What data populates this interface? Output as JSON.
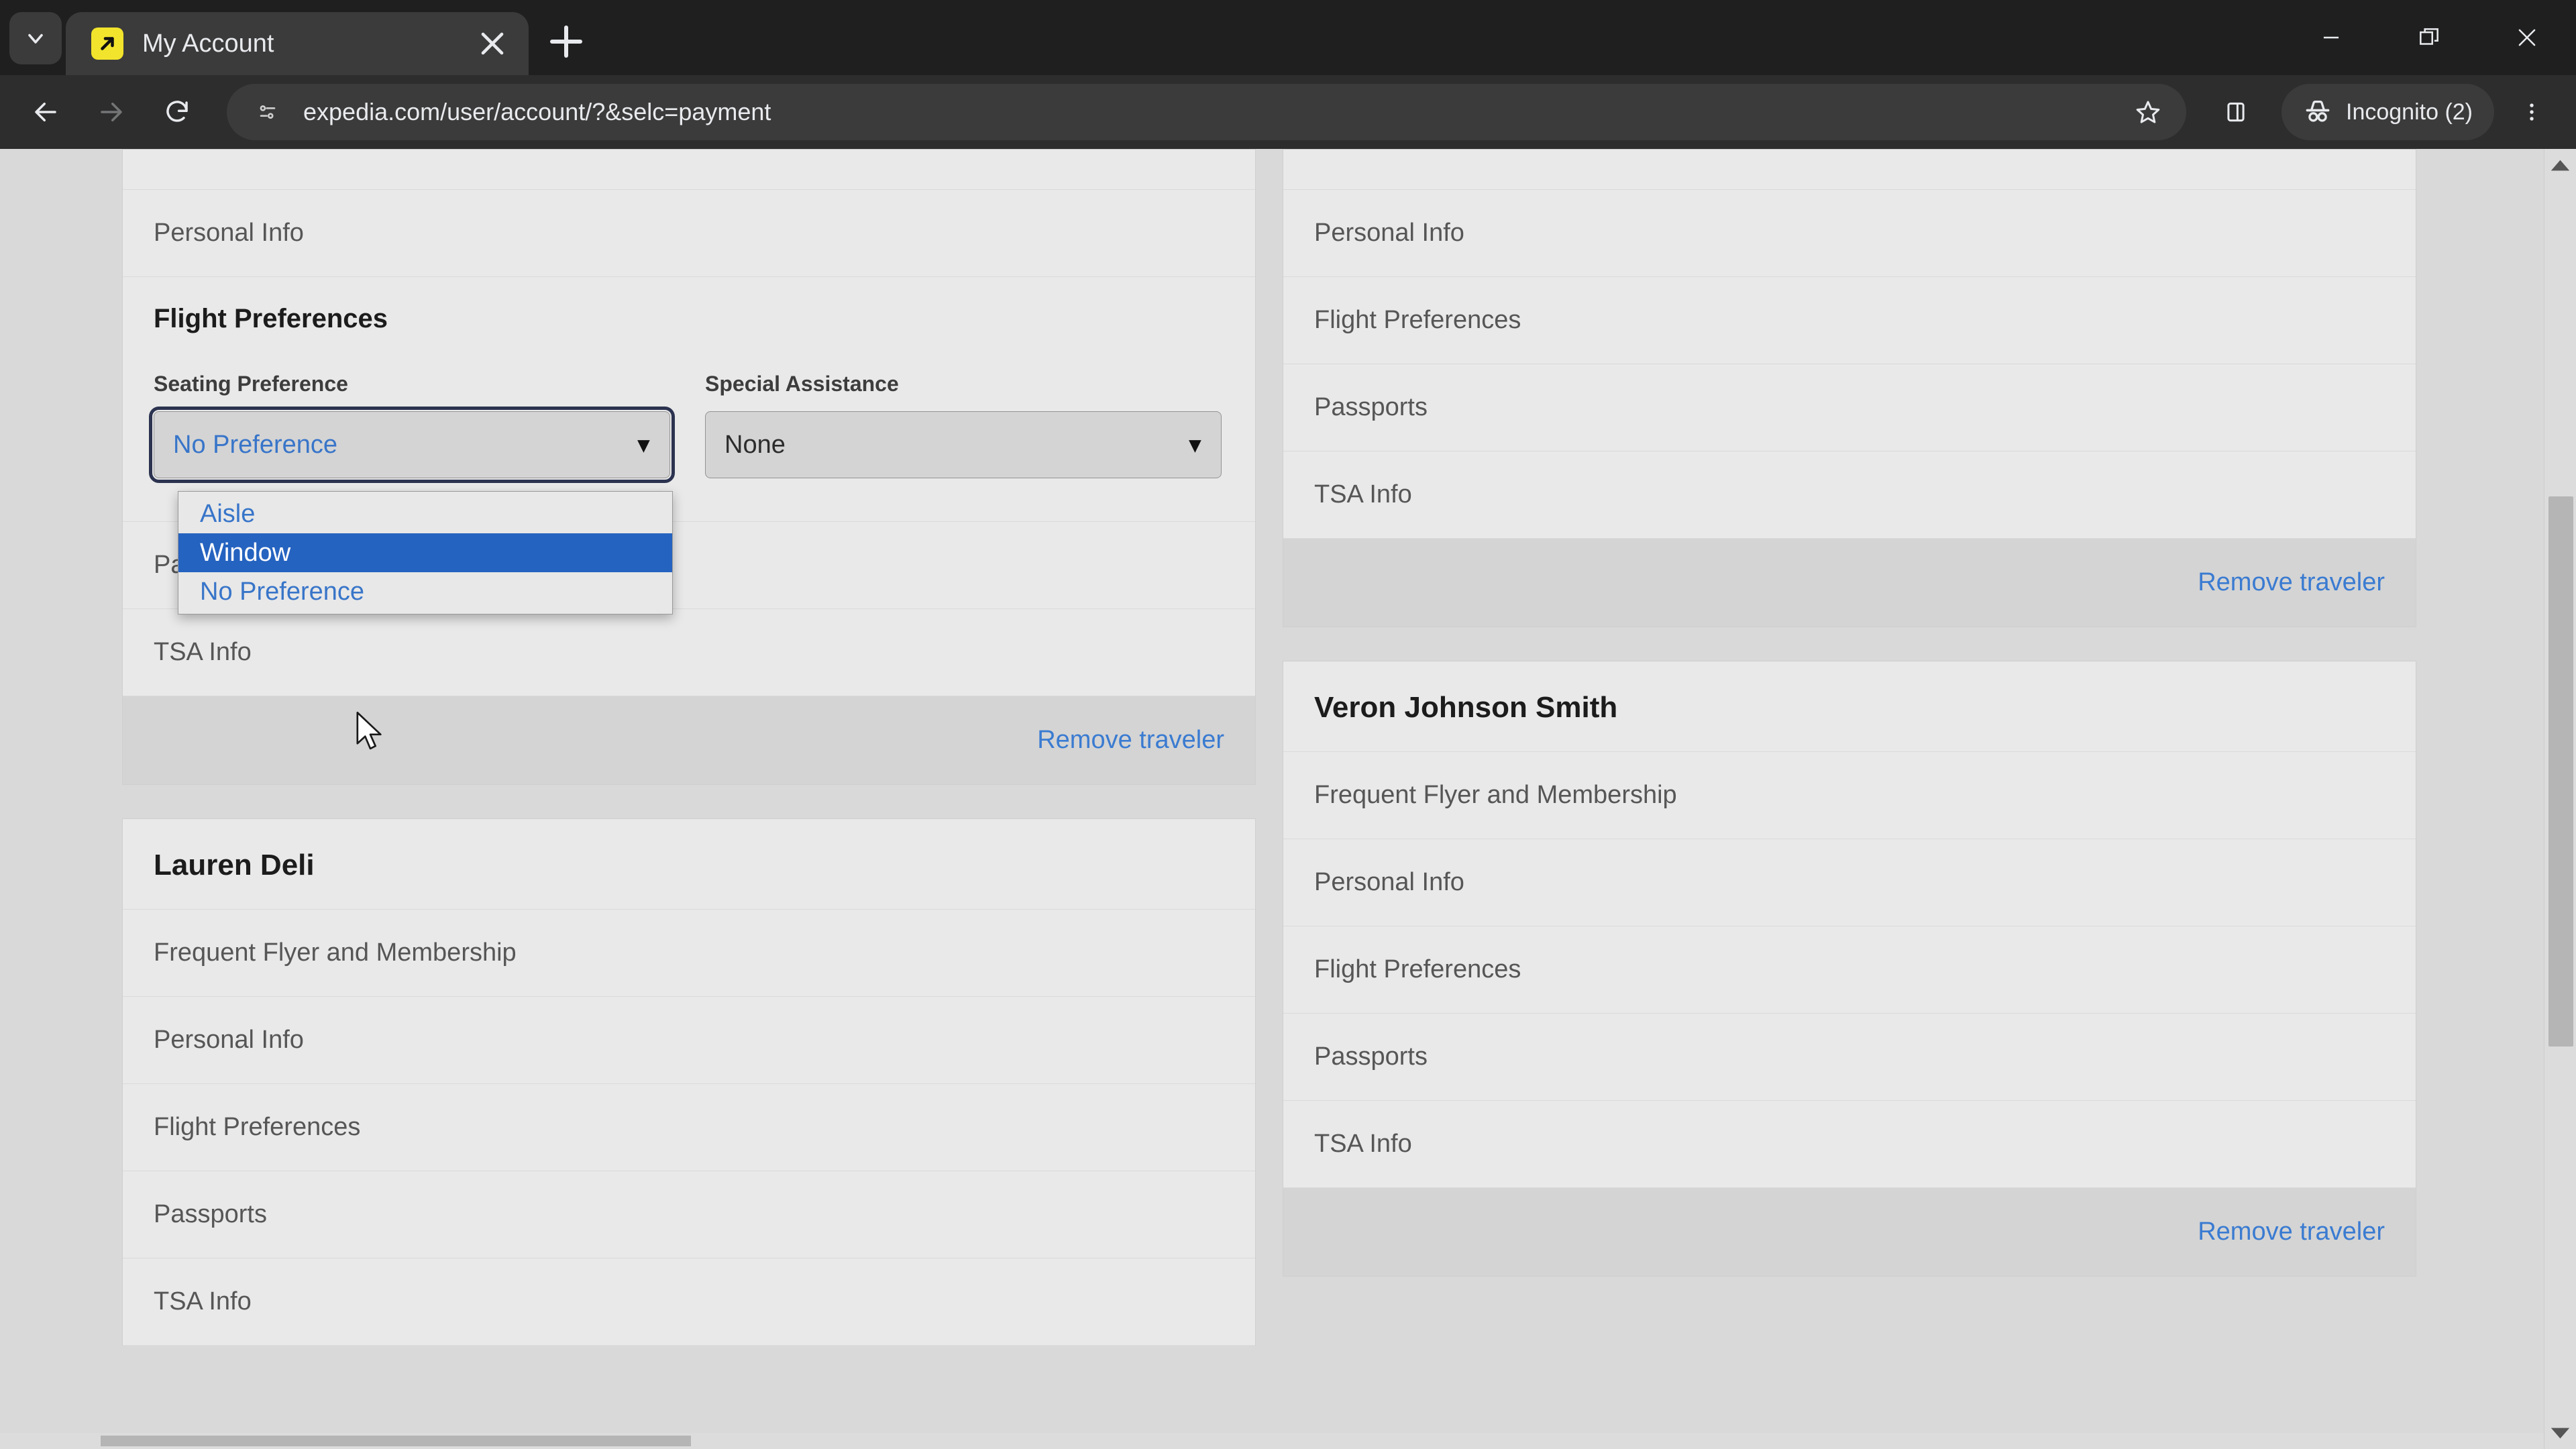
{
  "browser": {
    "tab": {
      "title": "My Account",
      "favicon_icon": "external-link-square-icon"
    },
    "tab_search_icon": "chevron-down-icon",
    "new_tab_icon": "plus-icon",
    "close_tab_icon": "close-icon",
    "window_controls": {
      "minimize_icon": "minimize-icon",
      "maximize_icon": "restore-icon",
      "close_icon": "close-icon"
    },
    "nav": {
      "back_icon": "arrow-left-icon",
      "forward_icon": "arrow-right-icon",
      "reload_icon": "reload-icon"
    },
    "omnibox": {
      "site_info_icon": "page-settings-icon",
      "url": "expedia.com/user/account/?&selc=payment",
      "bookmark_icon": "star-icon",
      "side_panel_icon": "side-panel-icon"
    },
    "incognito": {
      "label": "Incognito (2)",
      "icon": "incognito-hat-icon"
    },
    "menu_icon": "kebab-menu-icon"
  },
  "page": {
    "columns": [
      {
        "cards": [
          {
            "id": "card-traveler-open",
            "name": null,
            "rows": [
              {
                "label": "Personal Info",
                "expanded": false
              },
              {
                "label": "Flight Preferences",
                "expanded": true,
                "fields": [
                  {
                    "label": "Seating Preference",
                    "value": "No Preference",
                    "focused": true,
                    "caret_icon": "chevron-down-icon",
                    "open": true,
                    "options": [
                      {
                        "label": "Aisle",
                        "selected": false
                      },
                      {
                        "label": "Window",
                        "selected": true
                      },
                      {
                        "label": "No Preference",
                        "selected": false
                      }
                    ]
                  },
                  {
                    "label": "Special Assistance",
                    "value": "None",
                    "focused": false,
                    "caret_icon": "chevron-down-icon",
                    "open": false,
                    "options": []
                  }
                ]
              },
              {
                "label": "Passports",
                "expanded": false
              },
              {
                "label": "TSA Info",
                "expanded": false
              }
            ],
            "footer_label": "Remove traveler"
          },
          {
            "id": "card-lauren-deli",
            "name": "Lauren Deli",
            "rows": [
              {
                "label": "Frequent Flyer and Membership",
                "expanded": false
              },
              {
                "label": "Personal Info",
                "expanded": false
              },
              {
                "label": "Flight Preferences",
                "expanded": false
              },
              {
                "label": "Passports",
                "expanded": false
              },
              {
                "label": "TSA Info",
                "expanded": false
              }
            ],
            "footer_label": null
          }
        ]
      },
      {
        "cards": [
          {
            "id": "card-traveler-right-top",
            "name": null,
            "rows": [
              {
                "label": "Personal Info",
                "expanded": false
              },
              {
                "label": "Flight Preferences",
                "expanded": false
              },
              {
                "label": "Passports",
                "expanded": false
              },
              {
                "label": "TSA Info",
                "expanded": false
              }
            ],
            "footer_label": "Remove traveler"
          },
          {
            "id": "card-veron-johnson-smith",
            "name": "Veron Johnson Smith",
            "rows": [
              {
                "label": "Frequent Flyer and Membership",
                "expanded": false
              },
              {
                "label": "Personal Info",
                "expanded": false
              },
              {
                "label": "Flight Preferences",
                "expanded": false
              },
              {
                "label": "Passports",
                "expanded": false
              },
              {
                "label": "TSA Info",
                "expanded": false
              }
            ],
            "footer_label": "Remove traveler"
          }
        ]
      }
    ],
    "scrollbar": {
      "up_arrow_icon": "triangle-up-icon",
      "down_arrow_icon": "triangle-down-icon"
    }
  },
  "colors": {
    "link": "#3a7bd1",
    "option_highlight": "#2563c0",
    "focus_ring": "#2b3350",
    "card_bg": "#e9e9e9",
    "page_bg": "#d9d9d9",
    "favicon": "#f2e42c"
  }
}
